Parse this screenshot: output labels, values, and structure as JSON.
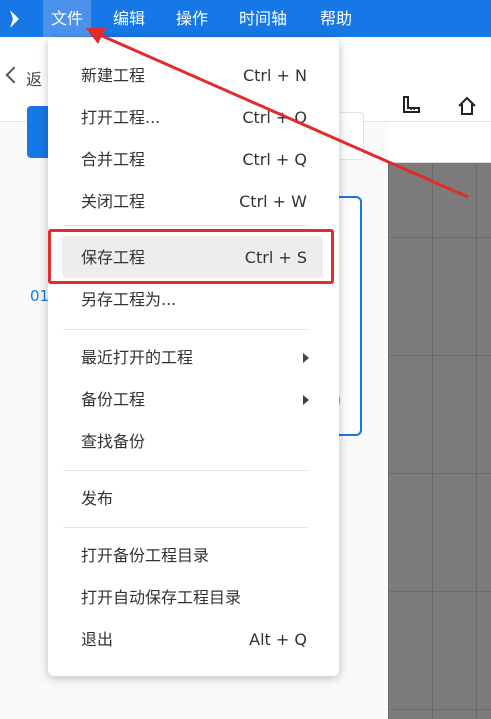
{
  "menubar": {
    "items": [
      "文件",
      "编辑",
      "操作",
      "时间轴",
      "帮助"
    ]
  },
  "topbar": {
    "back_label": "返"
  },
  "left_panel": {
    "side_number": "01",
    "card_paren": ")"
  },
  "file_menu": {
    "items": [
      {
        "label": "新建工程",
        "shortcut": "Ctrl + N"
      },
      {
        "label": "打开工程...",
        "shortcut": "Ctrl + O"
      },
      {
        "label": "合并工程",
        "shortcut": "Ctrl + Q"
      },
      {
        "label": "关闭工程",
        "shortcut": "Ctrl + W"
      },
      {
        "label": "保存工程",
        "shortcut": "Ctrl + S"
      },
      {
        "label": "另存工程为..."
      },
      {
        "label": "最近打开的工程"
      },
      {
        "label": "备份工程"
      },
      {
        "label": "查找备份"
      },
      {
        "label": "发布"
      },
      {
        "label": "打开备份工程目录"
      },
      {
        "label": "打开自动保存工程目录"
      },
      {
        "label": "退出",
        "shortcut": "Alt + Q"
      }
    ]
  },
  "colors": {
    "brand_blue": "#1677e6",
    "annotation_red": "#e22b2b",
    "canvas_gray": "#7b7b7b"
  },
  "icons": [
    "logo-icon",
    "chevron-left-icon",
    "ruler-icon",
    "home-icon",
    "submenu-arrow-icon"
  ]
}
